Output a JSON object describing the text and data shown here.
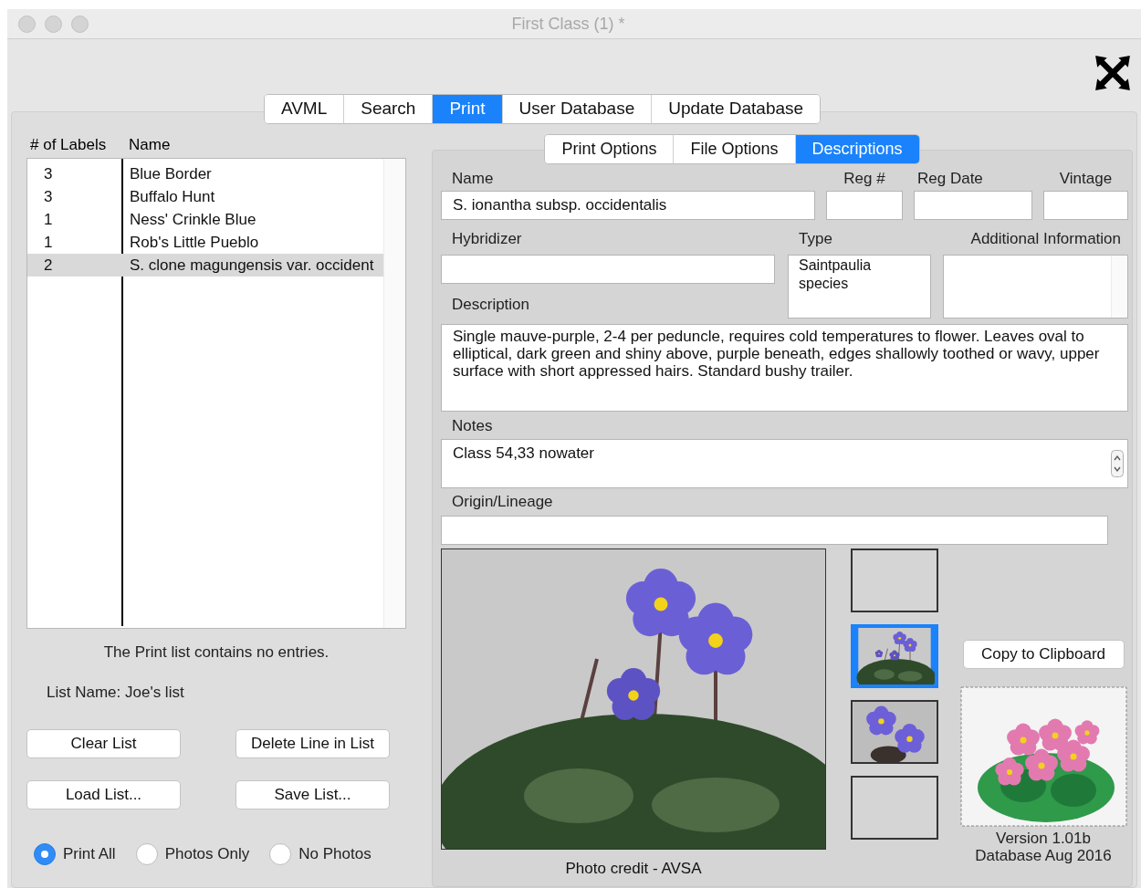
{
  "window": {
    "title": "First Class (1) *"
  },
  "main_tabs": [
    {
      "label": "AVML",
      "selected": false
    },
    {
      "label": "Search",
      "selected": false
    },
    {
      "label": "Print",
      "selected": true
    },
    {
      "label": "User Database",
      "selected": false
    },
    {
      "label": "Update Database",
      "selected": false
    }
  ],
  "print_list": {
    "columns": [
      "# of Labels",
      "Name"
    ],
    "rows": [
      {
        "count": "3",
        "name": "Blue Border",
        "selected": false
      },
      {
        "count": "3",
        "name": "Buffalo Hunt",
        "selected": false
      },
      {
        "count": "1",
        "name": "Ness' Crinkle Blue",
        "selected": false
      },
      {
        "count": "1",
        "name": "Rob's Little Pueblo",
        "selected": false
      },
      {
        "count": "2",
        "name": "S. clone magungensis var. occident",
        "selected": true
      }
    ],
    "status": "The Print list contains no entries.",
    "list_name": "List Name: Joe's list",
    "buttons": [
      "Clear List",
      "Delete Line in List",
      "Load List...",
      "Save List..."
    ],
    "print_mode": [
      {
        "label": "Print All",
        "selected": true
      },
      {
        "label": "Photos Only",
        "selected": false
      },
      {
        "label": "No Photos",
        "selected": false
      }
    ]
  },
  "details": {
    "tabs": [
      {
        "label": "Print Options",
        "selected": false
      },
      {
        "label": "File Options",
        "selected": false
      },
      {
        "label": "Descriptions",
        "selected": true
      }
    ],
    "name": {
      "label": "Name",
      "value": "S. ionantha subsp. occidentalis"
    },
    "reg_no": {
      "label": "Reg #"
    },
    "reg_date": {
      "label": "Reg Date"
    },
    "vintage": {
      "label": "Vintage"
    },
    "hybridizer": {
      "label": "Hybridizer"
    },
    "type": {
      "label": "Type",
      "value": "Saintpaulia\nspecies"
    },
    "additional_information": {
      "label": "Additional Information"
    },
    "description": {
      "label": "Description",
      "value": "Single mauve-purple, 2-4 per peduncle, requires cold temperatures to flower. Leaves oval to elliptical, dark green and shiny above, purple beneath, edges shallowly toothed or wavy, upper surface with short appressed hairs. Standard bushy trailer."
    },
    "notes": {
      "label": "Notes",
      "value": "Class 54,33 nowater"
    },
    "origin": {
      "label": "Origin/Lineage"
    },
    "photo_credit": "Photo credit - AVSA",
    "thumbnails": [
      {
        "kind": "empty",
        "selected": false
      },
      {
        "kind": "plant",
        "selected": true
      },
      {
        "kind": "flowers",
        "selected": false
      },
      {
        "kind": "empty",
        "selected": false
      }
    ],
    "copy_button": "Copy to Clipboard",
    "version": "Version 1.01b",
    "database": "Database Aug 2016"
  }
}
